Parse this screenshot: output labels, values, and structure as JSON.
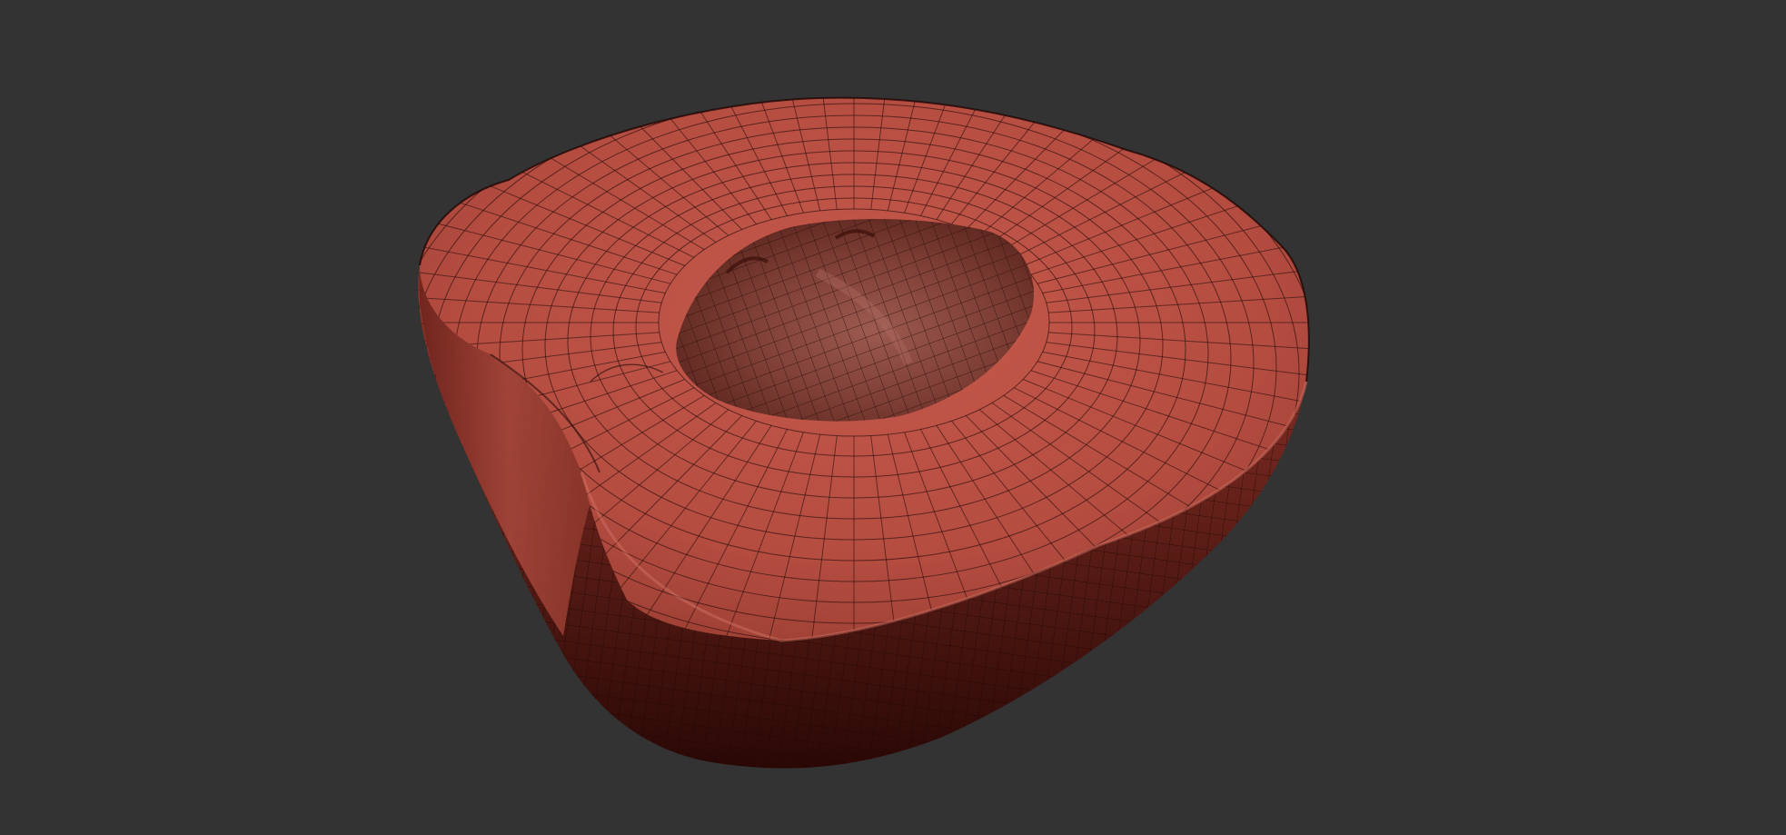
{
  "scene": {
    "background_color": "#333333",
    "object": "wireframe-clay-mesh",
    "colors": {
      "clay_light": "#c0564a",
      "clay_mid": "#a9463b",
      "clay_dark": "#5a1a14",
      "clay_shadow": "#2a0805",
      "crater": "#8a4a40",
      "wire": "#2a0d0a"
    }
  }
}
